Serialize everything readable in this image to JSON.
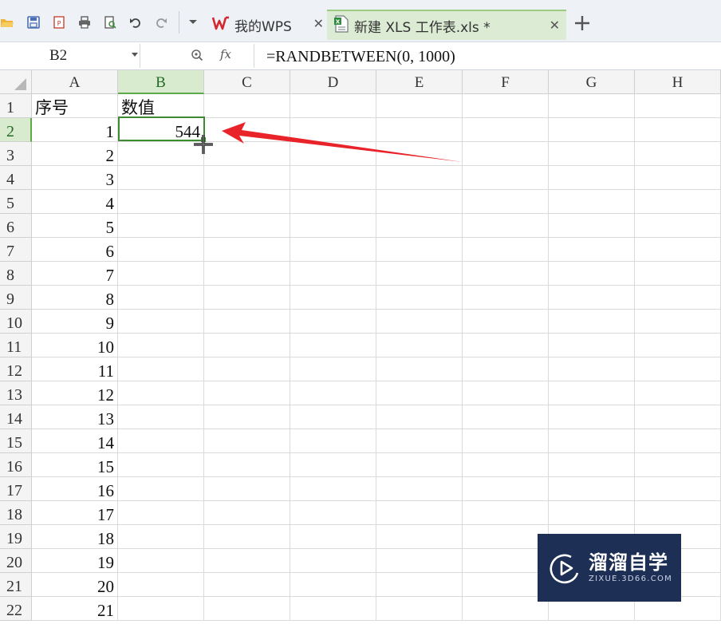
{
  "tabs": {
    "home": {
      "label": "我的WPS",
      "close": "✕"
    },
    "file": {
      "label": "新建 XLS 工作表.xls *",
      "close": "✕"
    },
    "new_tab": "+"
  },
  "quick_access": [
    "open-icon",
    "save-icon",
    "export-pdf-icon",
    "print-icon",
    "print-preview-icon",
    "undo-icon",
    "redo-icon",
    "customize-dropdown-icon"
  ],
  "formula_bar": {
    "name_box": "B2",
    "fx_label": "fx",
    "formula": "=RANDBETWEEN(0, 1000)"
  },
  "sheet": {
    "columns": [
      "A",
      "B",
      "C",
      "D",
      "E",
      "F",
      "G",
      "H"
    ],
    "rows": [
      "1",
      "2",
      "3",
      "4",
      "5",
      "6",
      "7",
      "8",
      "9",
      "10",
      "11",
      "12",
      "13",
      "14",
      "15",
      "16",
      "17",
      "18",
      "19",
      "20",
      "21",
      "22"
    ],
    "selected_column": "B",
    "selected_row": "2",
    "header_a": "序号",
    "header_b": "数值",
    "col_a_values": [
      "1",
      "2",
      "3",
      "4",
      "5",
      "6",
      "7",
      "8",
      "9",
      "10",
      "11",
      "12",
      "13",
      "14",
      "15",
      "16",
      "17",
      "18",
      "19",
      "20",
      "21"
    ],
    "b2_value": "544"
  },
  "annotation": {
    "arrow_color": "#e8242a"
  },
  "watermark": {
    "main": "溜溜自学",
    "sub": "ZIXUE.3D66.COM"
  },
  "colors": {
    "accent_green": "#3d8b31",
    "header_selected_bg": "#d9ebcf",
    "watermark_bg": "#1d2f55"
  }
}
